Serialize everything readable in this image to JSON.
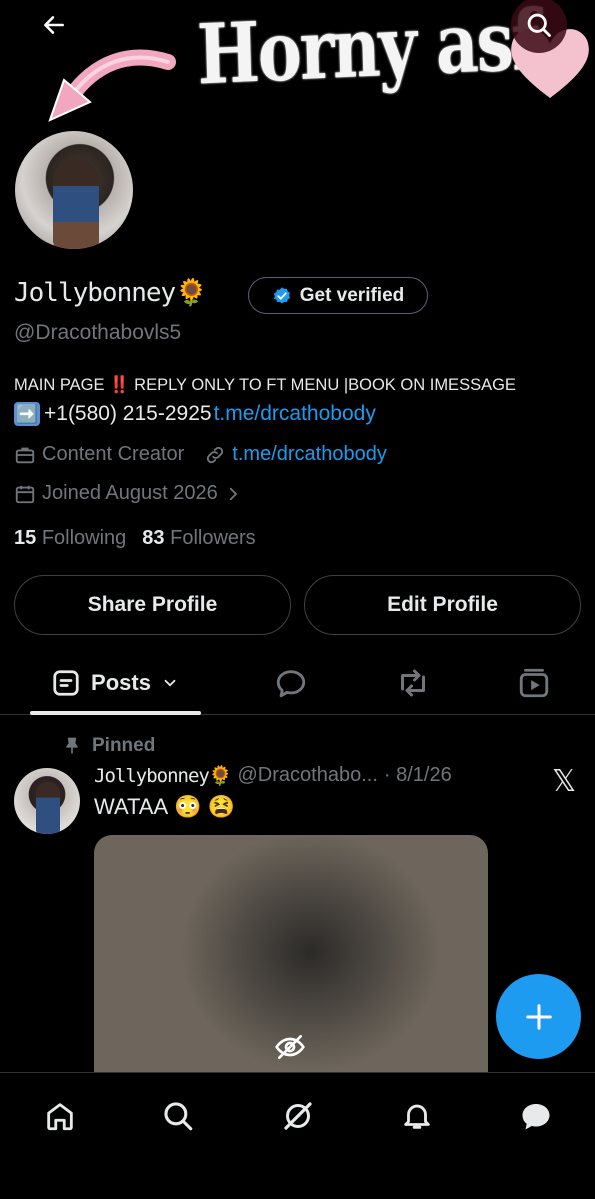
{
  "banner": {
    "text": "Horny asf"
  },
  "header": {
    "back_icon": "arrow-left-icon",
    "search_icon": "search-icon"
  },
  "profile": {
    "name": "Jollybonney🌻",
    "verify_label": "Get verified",
    "handle": "@Dracothabovls5",
    "bio_line1": "MAIN PAGE ‼️ REPLY ONLY TO FT MENU |BOOK ON IMESSAGE",
    "bio_line2_arrow": "➡️",
    "bio_line2_phone": "+1(580) 215-2925 ",
    "bio_line2_link": "t.me/drcathobody",
    "category": "Content Creator",
    "website": "t.me/drcathobody",
    "joined": "Joined August 2026",
    "following_count": "15",
    "following_label": "Following",
    "followers_count": "83",
    "followers_label": "Followers"
  },
  "actions": {
    "share": "Share Profile",
    "edit": "Edit Profile"
  },
  "tabs": {
    "posts": "Posts"
  },
  "post": {
    "pinned_label": "Pinned",
    "author_name": "Jollybonney🌻",
    "author_handle": "@Dracothabo...",
    "date": "· 8/1/26",
    "text": "WATAA",
    "emojis": [
      "😳",
      "😫"
    ]
  },
  "colors": {
    "accent": "#1d9bf0",
    "background": "#000000",
    "muted": "#71767b",
    "text": "#e7e9ea"
  }
}
